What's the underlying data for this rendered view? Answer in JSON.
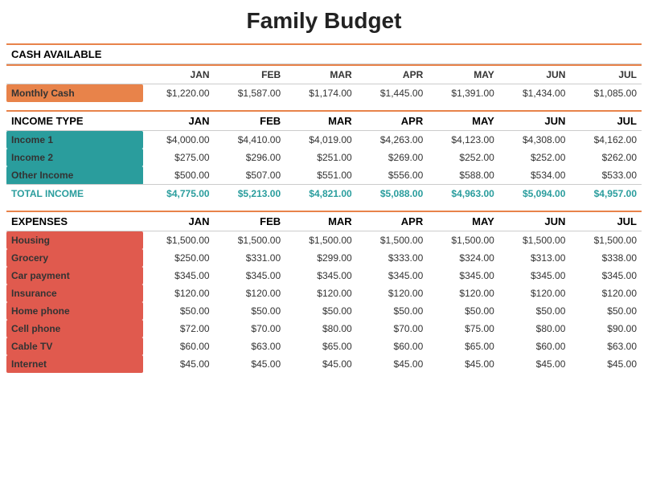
{
  "title": "Family Budget",
  "months": [
    "JAN",
    "FEB",
    "MAR",
    "APR",
    "MAY",
    "JUN",
    "JUL"
  ],
  "cashAvailable": {
    "sectionLabel": "CASH AVAILABLE",
    "rows": [
      {
        "label": "Monthly Cash",
        "labelStyle": "orange",
        "values": [
          "$1,220.00",
          "$1,587.00",
          "$1,174.00",
          "$1,445.00",
          "$1,391.00",
          "$1,434.00",
          "$1,085.00"
        ]
      }
    ]
  },
  "income": {
    "sectionLabel": "INCOME TYPE",
    "rows": [
      {
        "label": "Income 1",
        "labelStyle": "teal",
        "values": [
          "$4,000.00",
          "$4,410.00",
          "$4,019.00",
          "$4,263.00",
          "$4,123.00",
          "$4,308.00",
          "$4,162.00"
        ]
      },
      {
        "label": "Income 2",
        "labelStyle": "teal",
        "values": [
          "$275.00",
          "$296.00",
          "$251.00",
          "$269.00",
          "$252.00",
          "$252.00",
          "$262.00"
        ]
      },
      {
        "label": "Other Income",
        "labelStyle": "teal",
        "values": [
          "$500.00",
          "$507.00",
          "$551.00",
          "$556.00",
          "$588.00",
          "$534.00",
          "$533.00"
        ]
      }
    ],
    "total": {
      "label": "TOTAL INCOME",
      "values": [
        "$4,775.00",
        "$5,213.00",
        "$4,821.00",
        "$5,088.00",
        "$4,963.00",
        "$5,094.00",
        "$4,957.00"
      ]
    }
  },
  "expenses": {
    "sectionLabel": "EXPENSES",
    "rows": [
      {
        "label": "Housing",
        "labelStyle": "red",
        "values": [
          "$1,500.00",
          "$1,500.00",
          "$1,500.00",
          "$1,500.00",
          "$1,500.00",
          "$1,500.00",
          "$1,500.00"
        ]
      },
      {
        "label": "Grocery",
        "labelStyle": "red",
        "values": [
          "$250.00",
          "$331.00",
          "$299.00",
          "$333.00",
          "$324.00",
          "$313.00",
          "$338.00"
        ]
      },
      {
        "label": "Car payment",
        "labelStyle": "red",
        "values": [
          "$345.00",
          "$345.00",
          "$345.00",
          "$345.00",
          "$345.00",
          "$345.00",
          "$345.00"
        ]
      },
      {
        "label": "Insurance",
        "labelStyle": "red",
        "values": [
          "$120.00",
          "$120.00",
          "$120.00",
          "$120.00",
          "$120.00",
          "$120.00",
          "$120.00"
        ]
      },
      {
        "label": "Home phone",
        "labelStyle": "red",
        "values": [
          "$50.00",
          "$50.00",
          "$50.00",
          "$50.00",
          "$50.00",
          "$50.00",
          "$50.00"
        ]
      },
      {
        "label": "Cell phone",
        "labelStyle": "red",
        "values": [
          "$72.00",
          "$70.00",
          "$80.00",
          "$70.00",
          "$75.00",
          "$80.00",
          "$90.00"
        ]
      },
      {
        "label": "Cable TV",
        "labelStyle": "red",
        "values": [
          "$60.00",
          "$63.00",
          "$65.00",
          "$60.00",
          "$65.00",
          "$60.00",
          "$63.00"
        ]
      },
      {
        "label": "Internet",
        "labelStyle": "red",
        "values": [
          "$45.00",
          "$45.00",
          "$45.00",
          "$45.00",
          "$45.00",
          "$45.00",
          "$45.00"
        ]
      }
    ]
  }
}
